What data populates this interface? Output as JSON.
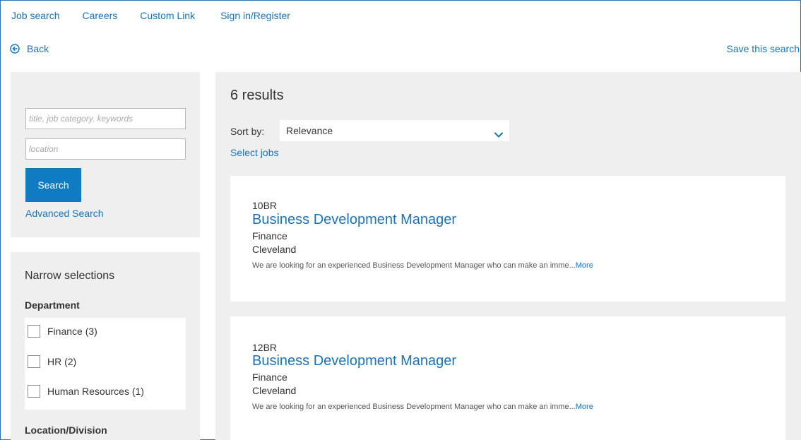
{
  "nav": {
    "items": [
      "Job search",
      "Careers",
      "Custom Link",
      "Sign in/Register"
    ]
  },
  "back_label": "Back",
  "save_search_label": "Save this search",
  "search": {
    "keywords_placeholder": "title, job category, keywords",
    "location_placeholder": "location",
    "button_label": "Search",
    "advanced_label": "Advanced Search"
  },
  "filters": {
    "title": "Narrow selections",
    "department_heading": "Department",
    "department_options": [
      {
        "label": "Finance (3)",
        "checked": false
      },
      {
        "label": "HR (2)",
        "checked": false
      },
      {
        "label": "Human Resources (1)",
        "checked": false
      }
    ],
    "location_heading": "Location/Division"
  },
  "results": {
    "count_label": "6 results",
    "sort_label": "Sort by:",
    "sort_value": "Relevance",
    "select_jobs_label": "Select jobs",
    "jobs": [
      {
        "id": "10BR",
        "title": "Business Development Manager",
        "department": "Finance",
        "location": "Cleveland",
        "description": "We are looking for an experienced Business Development Manager who can make an imme...",
        "more_label": "More"
      },
      {
        "id": "12BR",
        "title": "Business Development Manager",
        "department": "Finance",
        "location": "Cleveland",
        "description": "We are looking for an experienced Business Development Manager who can make an imme...",
        "more_label": "More"
      }
    ]
  },
  "colors": {
    "link": "#1a73b5",
    "primary_button": "#0f7cc1",
    "panel_bg": "#efefef",
    "frame_border": "#2e75b6"
  }
}
